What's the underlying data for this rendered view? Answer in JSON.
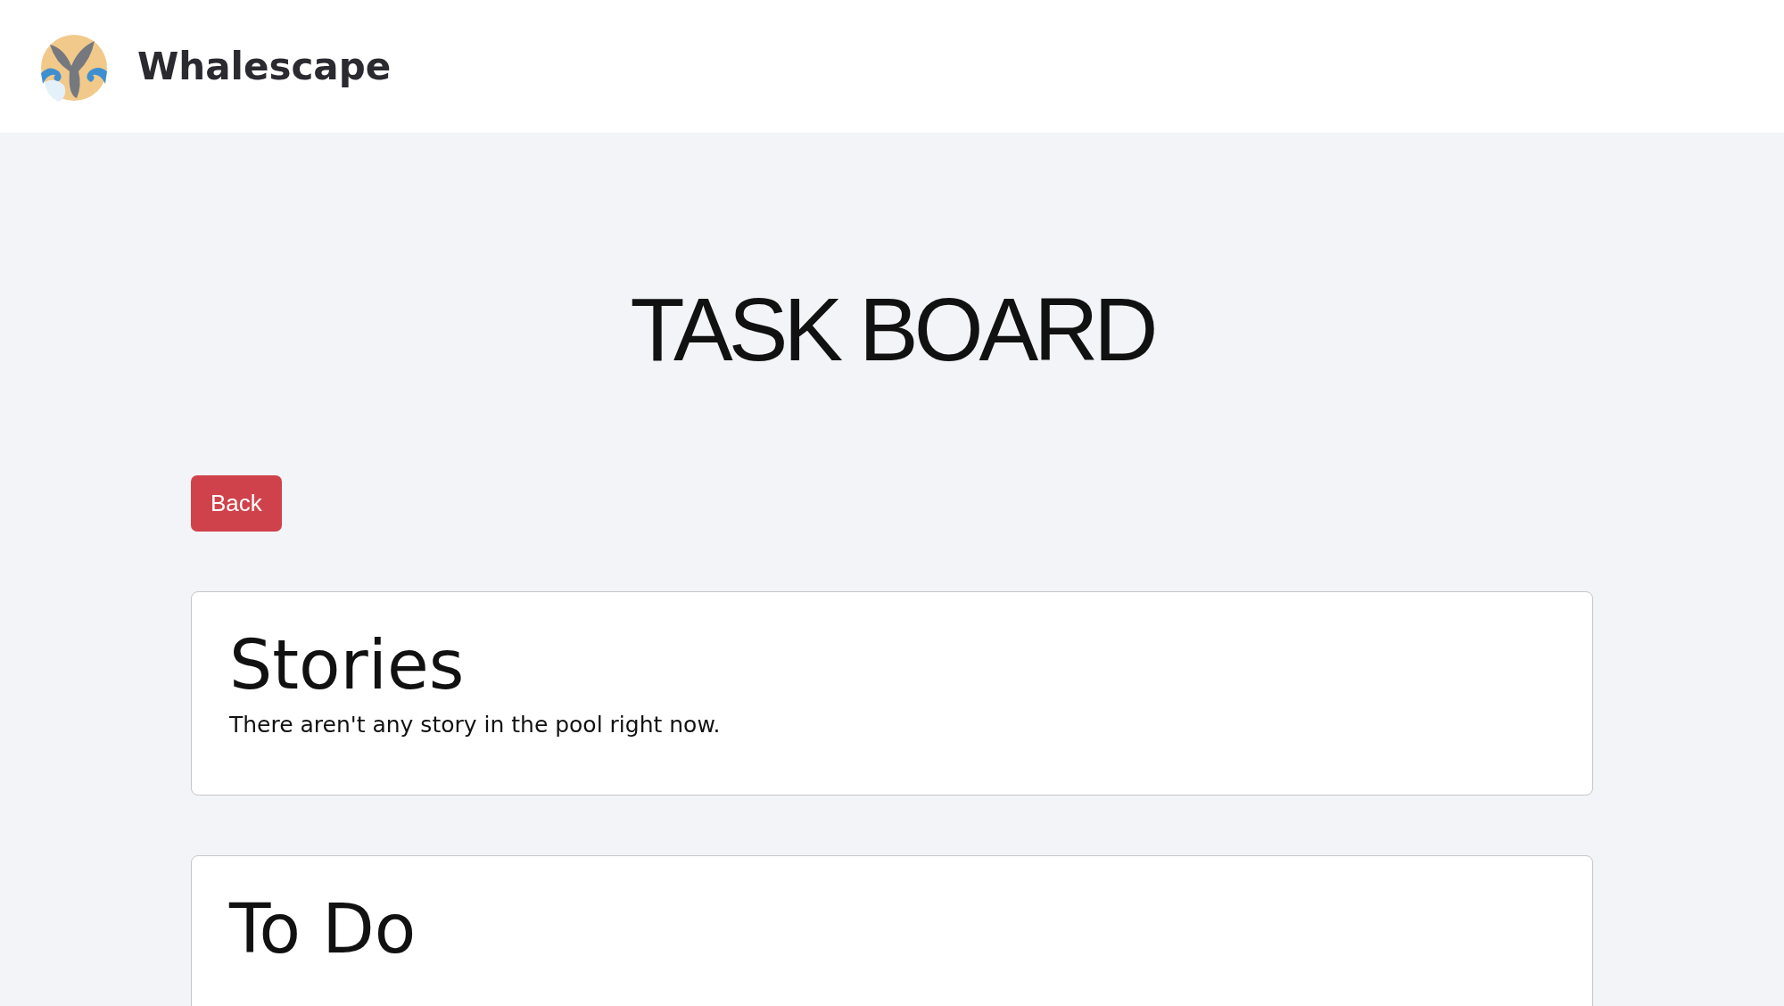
{
  "header": {
    "brand": "Whalescape"
  },
  "page_title": "TASK BOARD",
  "back_button": "Back",
  "sections": [
    {
      "title": "Stories",
      "message": "There aren't any story in the pool right now."
    },
    {
      "title": "To Do"
    }
  ]
}
